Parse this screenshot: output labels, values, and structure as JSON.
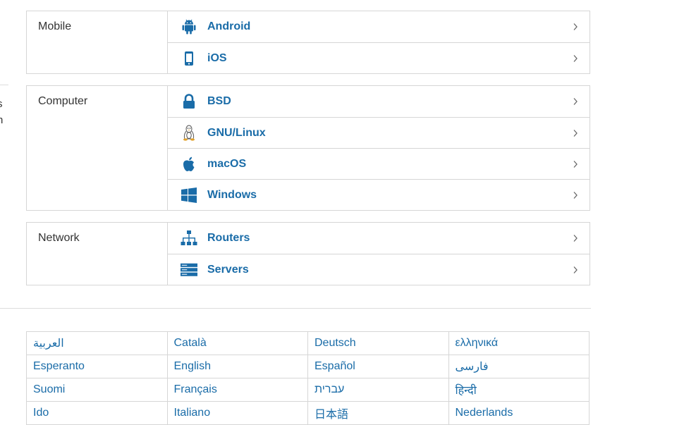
{
  "edge_fragments": [
    "s",
    "h"
  ],
  "groups": [
    {
      "label": "Mobile",
      "items": [
        {
          "label": "Android",
          "icon": "android-icon"
        },
        {
          "label": "iOS",
          "icon": "phone-icon"
        }
      ]
    },
    {
      "label": "Computer",
      "items": [
        {
          "label": "BSD",
          "icon": "lock-icon"
        },
        {
          "label": "GNU/Linux",
          "icon": "tux-icon"
        },
        {
          "label": "macOS",
          "icon": "apple-icon"
        },
        {
          "label": "Windows",
          "icon": "windows-icon"
        }
      ]
    },
    {
      "label": "Network",
      "items": [
        {
          "label": "Routers",
          "icon": "network-icon"
        },
        {
          "label": "Servers",
          "icon": "server-icon"
        }
      ]
    }
  ],
  "languages": [
    [
      "العربية",
      "Català",
      "Deutsch",
      "ελληνικά"
    ],
    [
      "Esperanto",
      "English",
      "Español",
      "فارسی"
    ],
    [
      "Suomi",
      "Français",
      "עברית",
      "हिन्दी"
    ],
    [
      "Ido",
      "Italiano",
      "日本語",
      "Nederlands"
    ]
  ],
  "colors": {
    "link": "#1a6ca8",
    "border": "#d6d6d6",
    "text": "#333333"
  }
}
